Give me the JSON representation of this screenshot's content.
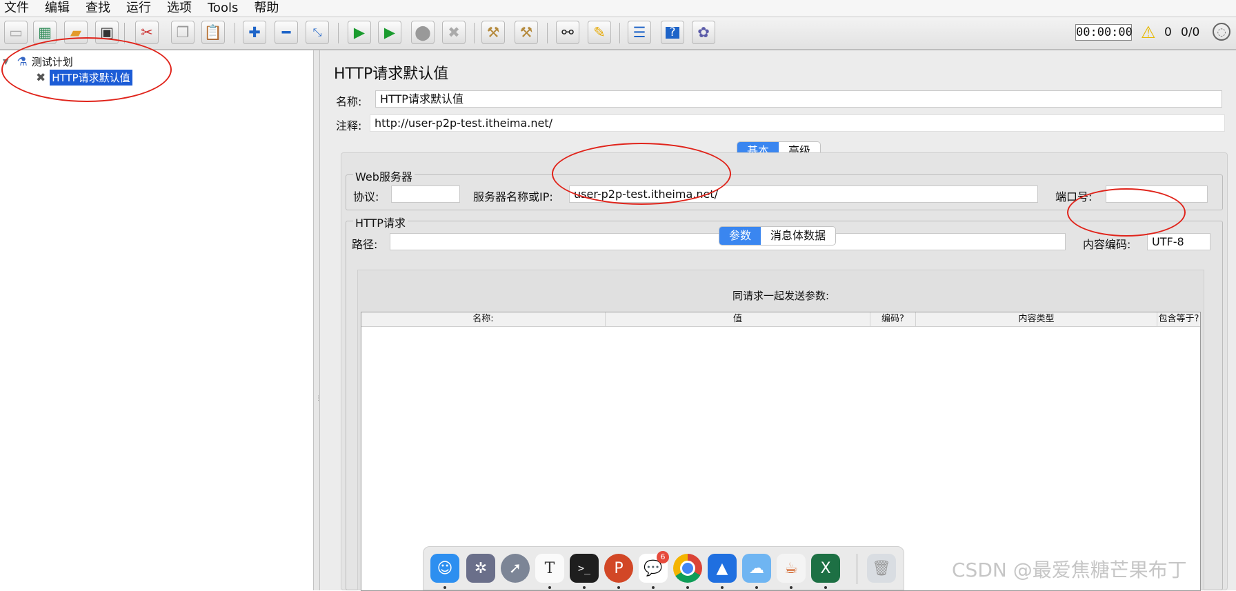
{
  "menu": [
    "文件",
    "编辑",
    "查找",
    "运行",
    "选项",
    "Tools",
    "帮助"
  ],
  "toolbar": {
    "icons": [
      "new-icon",
      "templates-icon",
      "open-icon",
      "save-icon",
      "cut-icon",
      "copy-icon",
      "paste-icon",
      "expand-icon",
      "collapse-icon",
      "toggle-icon",
      "start-icon",
      "start-no-pauses-icon",
      "stop-icon",
      "shutdown-icon",
      "clear-icon",
      "clear-all-icon",
      "search-icon",
      "reset-search-icon",
      "function-helper-icon",
      "help-icon",
      "remote-icon"
    ],
    "timer": "00:00:00",
    "warnings": "0",
    "threads": "0/0"
  },
  "tree": {
    "root": "测试计划",
    "child": "HTTP请求默认值"
  },
  "panel": {
    "title": "HTTP请求默认值",
    "name_label": "名称:",
    "name_value": "HTTP请求默认值",
    "comment_label": "注释:",
    "comment_value": "http://user-p2p-test.itheima.net/",
    "tabs": [
      "基本",
      "高级"
    ],
    "web_server": {
      "legend": "Web服务器",
      "protocol_label": "协议:",
      "protocol_value": "",
      "server_label": "服务器名称或IP:",
      "server_value": "user-p2p-test.itheima.net/",
      "port_label": "端口号:",
      "port_value": ""
    },
    "http_request": {
      "legend": "HTTP请求",
      "path_label": "路径:",
      "path_value": "",
      "encoding_label": "内容编码:",
      "encoding_value": "UTF-8"
    },
    "sub_tabs": [
      "参数",
      "消息体数据"
    ],
    "params_caption": "同请求一起发送参数:",
    "columns": [
      "名称:",
      "值",
      "编码?",
      "内容类型",
      "包含等于?"
    ]
  },
  "dock": {
    "icons": [
      "finder-icon",
      "photo-booth-icon",
      "launchpad-icon",
      "typora-icon",
      "terminal-icon",
      "powerpoint-icon",
      "messages-icon",
      "chrome-icon",
      "lanhu-icon",
      "cloud-icon",
      "java-icon",
      "excel-icon",
      "trash-icon"
    ],
    "badge": "6"
  },
  "watermark": "CSDN @最爱焦糖芒果布丁"
}
